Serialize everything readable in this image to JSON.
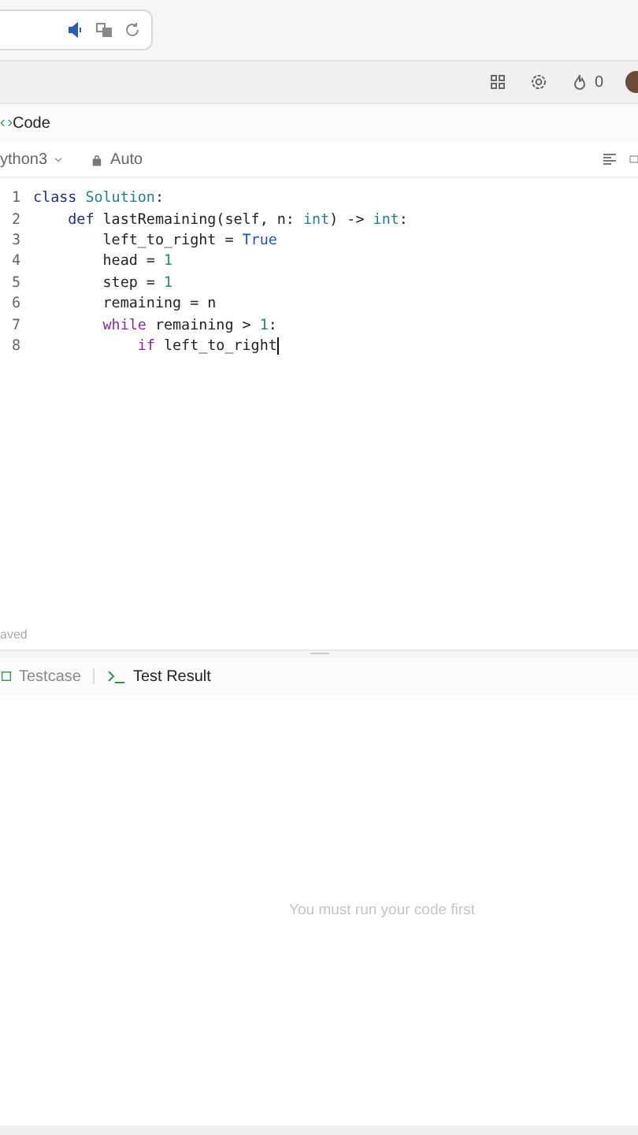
{
  "header": {
    "tab": {
      "label": "Code"
    },
    "streak": {
      "count": "0"
    }
  },
  "editor": {
    "language": "ython3",
    "mode": "Auto",
    "lines": [
      {
        "number": "1",
        "tokens": [
          {
            "kind": "keyword",
            "text": "class"
          },
          {
            "kind": "type",
            "text": " Solution"
          },
          {
            "kind": "plain",
            "text": ":"
          }
        ]
      },
      {
        "number": "2",
        "tokens": [
          {
            "kind": "keyword",
            "text": "    def"
          },
          {
            "kind": "plain",
            "text": " lastRemaining(self, n: "
          },
          {
            "kind": "type",
            "text": "int"
          },
          {
            "kind": "plain",
            "text": ") -> "
          },
          {
            "kind": "type",
            "text": "int"
          },
          {
            "kind": "plain",
            "text": ":"
          }
        ]
      },
      {
        "number": "3",
        "tokens": [
          {
            "kind": "plain",
            "text": "        left_to_right = "
          },
          {
            "kind": "constant",
            "text": "True"
          }
        ]
      },
      {
        "number": "4",
        "tokens": [
          {
            "kind": "plain",
            "text": "        head = "
          },
          {
            "kind": "number",
            "text": "1"
          }
        ]
      },
      {
        "number": "5",
        "tokens": [
          {
            "kind": "plain",
            "text": "        step = "
          },
          {
            "kind": "number",
            "text": "1"
          }
        ]
      },
      {
        "number": "6",
        "tokens": [
          {
            "kind": "plain",
            "text": "        remaining = n"
          }
        ]
      },
      {
        "number": "7",
        "tokens": [
          {
            "kind": "control",
            "text": "        while"
          },
          {
            "kind": "plain",
            "text": " remaining > "
          },
          {
            "kind": "number",
            "text": "1"
          },
          {
            "kind": "plain",
            "text": ":"
          }
        ]
      },
      {
        "number": "8",
        "tokens": [
          {
            "kind": "control",
            "text": "            if"
          },
          {
            "kind": "plain",
            "text": " left_to_right"
          }
        ]
      }
    ],
    "status": "aved"
  },
  "console": {
    "tabs": [
      {
        "label": "Testcase",
        "selected": false
      },
      {
        "label": "Test Result",
        "selected": true
      }
    ],
    "message": "You must run your code first"
  }
}
